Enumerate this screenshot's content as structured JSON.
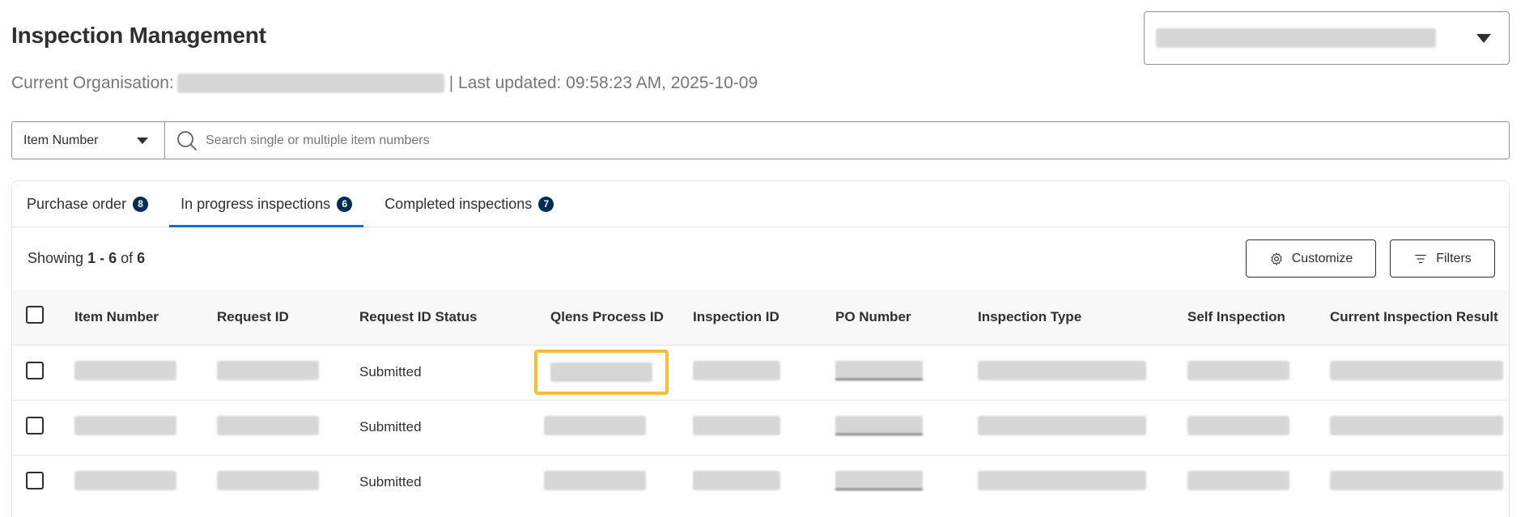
{
  "header": {
    "title": "Inspection Management",
    "org_label": "Current Organisation:",
    "last_updated": "| Last updated: 09:58:23 AM, 2025-10-09"
  },
  "search": {
    "type_selected": "Item Number",
    "placeholder": "Search single or multiple item numbers"
  },
  "tabs": [
    {
      "label": "Purchase order",
      "count": "8"
    },
    {
      "label": "In progress inspections",
      "count": "6"
    },
    {
      "label": "Completed inspections",
      "count": "7"
    }
  ],
  "toolbar": {
    "showing_prefix": "Showing",
    "range": "1 - 6",
    "of": "of",
    "total": "6",
    "customize_label": "Customize",
    "filters_label": "Filters"
  },
  "table": {
    "columns": [
      "Item Number",
      "Request ID",
      "Request ID Status",
      "Qlens Process ID",
      "Inspection ID",
      "PO Number",
      "Inspection Type",
      "Self Inspection",
      "Current Inspection Result"
    ],
    "rows": [
      {
        "status": "Submitted"
      },
      {
        "status": "Submitted"
      },
      {
        "status": "Submitted"
      }
    ]
  },
  "colors": {
    "tab_active": "#0071dc",
    "badge": "#002d58",
    "highlight": "#f4bf36"
  }
}
